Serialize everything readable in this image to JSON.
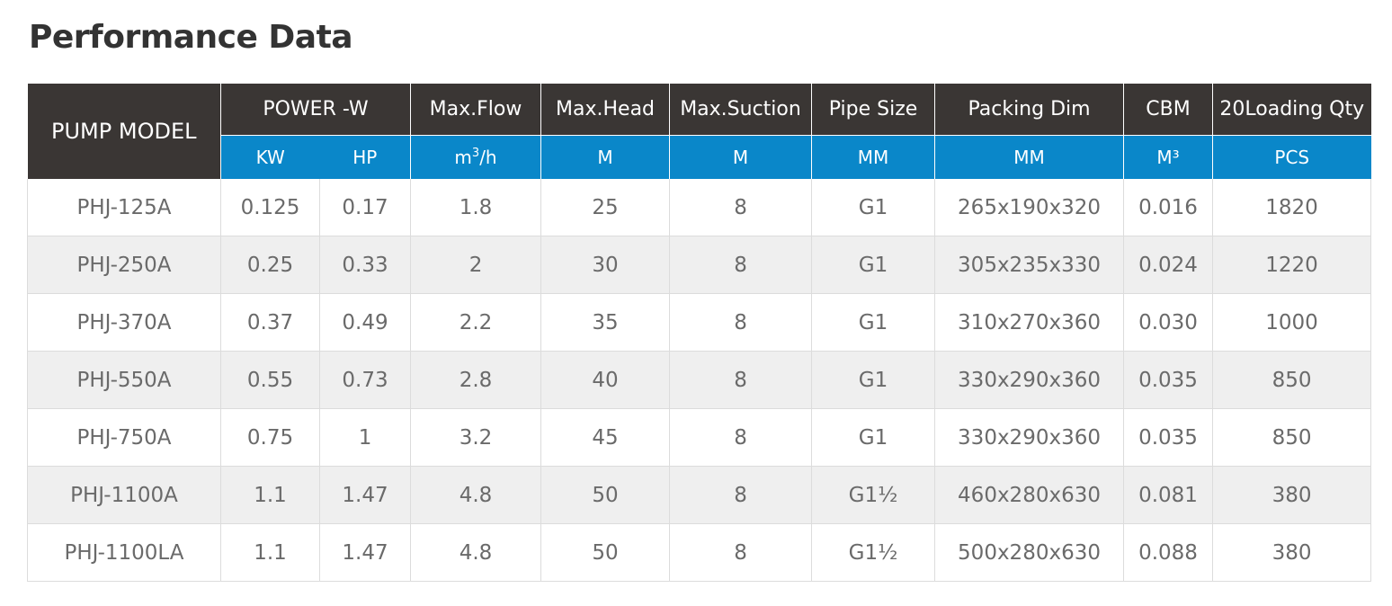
{
  "title": "Performance Data",
  "header": {
    "model": "PUMP MODEL",
    "power": "POWER -W",
    "max_flow": "Max.Flow",
    "max_head": "Max.Head",
    "max_suction": "Max.Suction",
    "pipe_size": "Pipe Size",
    "packing_dim": "Packing Dim",
    "cbm": "CBM",
    "loading_qty": "20Loading Qty"
  },
  "units": {
    "kw": "KW",
    "hp": "HP",
    "flow_base": "m",
    "flow_sup": "3",
    "flow_tail": "/h",
    "head": "M",
    "suction": "M",
    "pipe": "MM",
    "packing": "MM",
    "cbm": "M³",
    "qty": "PCS"
  },
  "rows": [
    {
      "model": "PHJ-125A",
      "kw": "0.125",
      "hp": "0.17",
      "flow": "1.8",
      "head": "25",
      "suction": "8",
      "pipe": "G1",
      "packing": "265x190x320",
      "cbm": "0.016",
      "qty": "1820"
    },
    {
      "model": "PHJ-250A",
      "kw": "0.25",
      "hp": "0.33",
      "flow": "2",
      "head": "30",
      "suction": "8",
      "pipe": "G1",
      "packing": "305x235x330",
      "cbm": "0.024",
      "qty": "1220"
    },
    {
      "model": "PHJ-370A",
      "kw": "0.37",
      "hp": "0.49",
      "flow": "2.2",
      "head": "35",
      "suction": "8",
      "pipe": "G1",
      "packing": "310x270x360",
      "cbm": "0.030",
      "qty": "1000"
    },
    {
      "model": "PHJ-550A",
      "kw": "0.55",
      "hp": "0.73",
      "flow": "2.8",
      "head": "40",
      "suction": "8",
      "pipe": "G1",
      "packing": "330x290x360",
      "cbm": "0.035",
      "qty": "850"
    },
    {
      "model": "PHJ-750A",
      "kw": "0.75",
      "hp": "1",
      "flow": "3.2",
      "head": "45",
      "suction": "8",
      "pipe": "G1",
      "packing": "330x290x360",
      "cbm": "0.035",
      "qty": "850"
    },
    {
      "model": "PHJ-1100A",
      "kw": "1.1",
      "hp": "1.47",
      "flow": "4.8",
      "head": "50",
      "suction": "8",
      "pipe": "G1½",
      "packing": "460x280x630",
      "cbm": "0.081",
      "qty": "380"
    },
    {
      "model": "PHJ-1100LA",
      "kw": "1.1",
      "hp": "1.47",
      "flow": "4.8",
      "head": "50",
      "suction": "8",
      "pipe": "G1½",
      "packing": "500x280x630",
      "cbm": "0.088",
      "qty": "380"
    }
  ],
  "colors": {
    "header_dark": "#3a3634",
    "header_blue": "#0a87c9",
    "row_alt": "#efefef",
    "text": "#6a6a6a"
  }
}
